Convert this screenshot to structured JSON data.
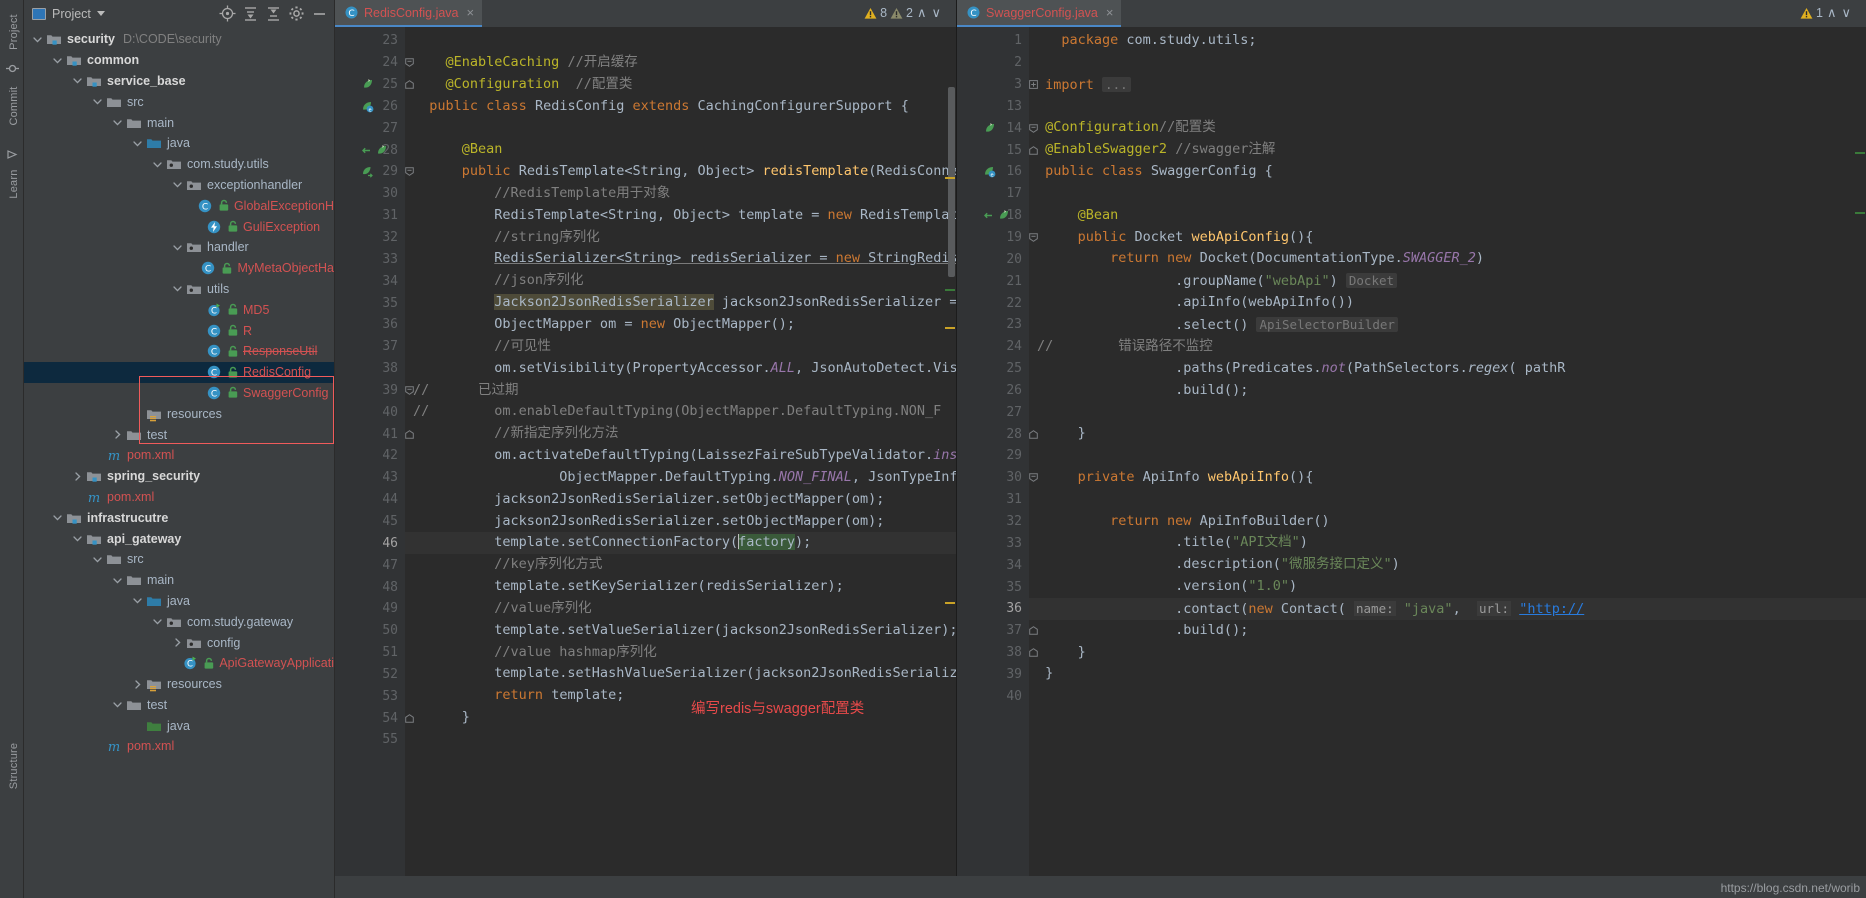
{
  "toolwindows": {
    "left_tabs": [
      "Project",
      "Commit",
      "Learn"
    ],
    "bottom_tab": "Structure"
  },
  "project_panel": {
    "title": "Project",
    "icons": [
      "locate-icon",
      "expand-all-icon",
      "collapse-all-icon",
      "settings-icon",
      "hide-icon"
    ],
    "tree": [
      {
        "depth": 0,
        "arrow": "down",
        "icon": "module-folder",
        "label": "security",
        "bold": true,
        "path": "D:\\CODE\\security"
      },
      {
        "depth": 1,
        "arrow": "down",
        "icon": "module-folder",
        "label": "common",
        "bold": true
      },
      {
        "depth": 2,
        "arrow": "down",
        "icon": "module-folder",
        "label": "service_base",
        "bold": true
      },
      {
        "depth": 3,
        "arrow": "down",
        "icon": "folder",
        "label": "src"
      },
      {
        "depth": 4,
        "arrow": "down",
        "icon": "folder",
        "label": "main"
      },
      {
        "depth": 5,
        "arrow": "down",
        "icon": "source-folder",
        "label": "java"
      },
      {
        "depth": 6,
        "arrow": "down",
        "icon": "package",
        "label": "com.study.utils"
      },
      {
        "depth": 7,
        "arrow": "down",
        "icon": "package",
        "label": "exceptionhandler"
      },
      {
        "depth": 8,
        "arrow": "none",
        "icon": "java-class",
        "label": "GlobalExceptionH",
        "kind": "class"
      },
      {
        "depth": 8,
        "arrow": "none",
        "icon": "java-annotation",
        "label": "GuliException",
        "kind": "class"
      },
      {
        "depth": 7,
        "arrow": "down",
        "icon": "package",
        "label": "handler"
      },
      {
        "depth": 8,
        "arrow": "none",
        "icon": "java-class",
        "label": "MyMetaObjectHa",
        "kind": "class"
      },
      {
        "depth": 7,
        "arrow": "down",
        "icon": "package",
        "label": "utils"
      },
      {
        "depth": 8,
        "arrow": "none",
        "icon": "java-class-run",
        "label": "MD5",
        "kind": "class"
      },
      {
        "depth": 8,
        "arrow": "none",
        "icon": "java-class",
        "label": "R",
        "kind": "class"
      },
      {
        "depth": 8,
        "arrow": "none",
        "icon": "java-class",
        "label": "ResponseUtil",
        "kind": "class",
        "strike": true
      },
      {
        "depth": 8,
        "arrow": "none",
        "icon": "java-class",
        "label": "RedisConfig",
        "kind": "class",
        "selected": true
      },
      {
        "depth": 8,
        "arrow": "none",
        "icon": "java-class",
        "label": "SwaggerConfig",
        "kind": "class"
      },
      {
        "depth": 5,
        "arrow": "none",
        "icon": "resources-folder",
        "label": "resources"
      },
      {
        "depth": 4,
        "arrow": "right",
        "icon": "folder",
        "label": "test"
      },
      {
        "depth": 3,
        "arrow": "none",
        "icon": "maven",
        "label": "pom.xml",
        "kind": "class"
      },
      {
        "depth": 2,
        "arrow": "right",
        "icon": "module-folder",
        "label": "spring_security",
        "bold": true
      },
      {
        "depth": 2,
        "arrow": "none",
        "icon": "maven",
        "label": "pom.xml",
        "kind": "class"
      },
      {
        "depth": 1,
        "arrow": "down",
        "icon": "module-folder",
        "label": "infrastrucutre",
        "bold": true
      },
      {
        "depth": 2,
        "arrow": "down",
        "icon": "module-folder",
        "label": "api_gateway",
        "bold": true
      },
      {
        "depth": 3,
        "arrow": "down",
        "icon": "folder",
        "label": "src"
      },
      {
        "depth": 4,
        "arrow": "down",
        "icon": "folder",
        "label": "main"
      },
      {
        "depth": 5,
        "arrow": "down",
        "icon": "source-folder",
        "label": "java"
      },
      {
        "depth": 6,
        "arrow": "down",
        "icon": "package",
        "label": "com.study.gateway"
      },
      {
        "depth": 7,
        "arrow": "right",
        "icon": "package",
        "label": "config"
      },
      {
        "depth": 7,
        "arrow": "none",
        "icon": "java-class-run",
        "label": "ApiGatewayApplicati",
        "kind": "class"
      },
      {
        "depth": 5,
        "arrow": "right",
        "icon": "resources-folder",
        "label": "resources"
      },
      {
        "depth": 4,
        "arrow": "down",
        "icon": "folder",
        "label": "test"
      },
      {
        "depth": 5,
        "arrow": "none",
        "icon": "source-folder-test",
        "label": "java"
      },
      {
        "depth": 3,
        "arrow": "none",
        "icon": "maven",
        "label": "pom.xml",
        "kind": "class"
      }
    ]
  },
  "left_editor": {
    "tab": {
      "label": "RedisConfig.java",
      "icon": "java-class-icon",
      "close": "×"
    },
    "inspections": {
      "error_count": "8",
      "warning_count": "2",
      "up": "∧",
      "down": "∨"
    },
    "first_line": 23,
    "current_line": 46,
    "lines": [
      {
        "n": 23,
        "html": ""
      },
      {
        "n": 24,
        "html": "    <span class=\"ann\">@EnableCaching</span> <span class=\"cmt\">//开启缓存</span>",
        "fold": "minus"
      },
      {
        "n": 25,
        "html": "    <span class=\"ann\">@Configuration</span>  <span class=\"cmt\">//配置类</span>",
        "gutter": "bean",
        "fold": "end"
      },
      {
        "n": 26,
        "html": "  <span class=\"kw\">public class </span>RedisConfig<span class=\"kw\"> extends </span>CachingConfigurerSupport {",
        "gutter": "bean2"
      },
      {
        "n": 27,
        "html": ""
      },
      {
        "n": 28,
        "html": "      <span class=\"ann\">@Bean</span>",
        "gutter": "bean-arrow"
      },
      {
        "n": 29,
        "html": "      <span class=\"kw\">public </span>RedisTemplate&lt;String, Object&gt; <span class=\"mth\">redisTemplate</span>(RedisConne",
        "gutter": "impl",
        "fold": "minus"
      },
      {
        "n": 30,
        "html": "          <span class=\"cmt\">//RedisTemplate用于对象</span>"
      },
      {
        "n": 31,
        "html": "          RedisTemplate&lt;String, Object&gt; template = <span class=\"kw\">new </span>RedisTemplat"
      },
      {
        "n": 32,
        "html": "          <span class=\"cmt\">//string序列化</span>"
      },
      {
        "n": 33,
        "html": "          <span class=\"undl\">RedisSerializer&lt;String&gt; redisSerializer = <span class=\"kw\">new </span>StringRedis</span>"
      },
      {
        "n": 34,
        "html": "          <span class=\"cmt\">//json序列化</span>"
      },
      {
        "n": 35,
        "html": "          <span class=\"hl\">Jackson2JsonRedisSerializer</span> jackson2JsonRedisSerializer ="
      },
      {
        "n": 36,
        "html": "          ObjectMapper om = <span class=\"kw\">new </span>ObjectMapper();"
      },
      {
        "n": 37,
        "html": "          <span class=\"cmt\">//可见性</span>"
      },
      {
        "n": 38,
        "html": "          om.setVisibility(PropertyAccessor.<span class=\"sfld\">ALL</span>, JsonAutoDetect.Vis"
      },
      {
        "n": 39,
        "html": "<span class=\"cmt\">//      已过期</span>",
        "fold": "minus",
        "comment_row": true
      },
      {
        "n": 40,
        "html": "<span class=\"cmt\">//        om.enableDefaultTyping(ObjectMapper.DefaultTyping.NON_F</span>",
        "comment_row": true
      },
      {
        "n": 41,
        "html": "          <span class=\"cmt\">//新指定序列化方法</span>",
        "fold": "end"
      },
      {
        "n": 42,
        "html": "          om.activateDefaultTyping(LaissezFaireSubTypeValidator.<span class=\"sfld\">ins</span>"
      },
      {
        "n": 43,
        "html": "                  ObjectMapper.DefaultTyping.<span class=\"sfld\">NON_FINAL</span>, JsonTypeInf"
      },
      {
        "n": 44,
        "html": "          jackson2JsonRedisSerializer.setObjectMapper(om);"
      },
      {
        "n": 45,
        "html": "          jackson2JsonRedisSerializer.setObjectMapper(om);"
      },
      {
        "n": 46,
        "html": "          template.setConnectionFactory(<span class=\"selgreen\"><span class=\"caretbar\"></span>factory</span>);",
        "current": true
      },
      {
        "n": 47,
        "html": "          <span class=\"cmt\">//key序列化方式</span>"
      },
      {
        "n": 48,
        "html": "          template.setKeySerializer(redisSerializer);"
      },
      {
        "n": 49,
        "html": "          <span class=\"cmt\">//value序列化</span>"
      },
      {
        "n": 50,
        "html": "          template.setValueSerializer(jackson2JsonRedisSerializer);"
      },
      {
        "n": 51,
        "html": "          <span class=\"cmt\">//value hashmap序列化</span>"
      },
      {
        "n": 52,
        "html": "          template.setHashValueSerializer(jackson2JsonRedisSerializ"
      },
      {
        "n": 53,
        "html": "          <span class=\"kw\">return </span>template;"
      },
      {
        "n": 54,
        "html": "      }",
        "fold": "end"
      },
      {
        "n": 55,
        "html": ""
      }
    ]
  },
  "right_editor": {
    "tab": {
      "label": "SwaggerConfig.java",
      "icon": "java-class-icon",
      "close": "×"
    },
    "inspections": {
      "warning_count": "1",
      "up": "∧",
      "down": "∨"
    },
    "current_line": 36,
    "lines": [
      {
        "n": 1,
        "html": "   <span class=\"kw\">package </span>com.study.utils;"
      },
      {
        "n": 2,
        "html": ""
      },
      {
        "n": 3,
        "html": " <span class=\"kw\">import </span><span class=\"hint\">...</span>",
        "fold": "plus"
      },
      {
        "n": 13,
        "html": ""
      },
      {
        "n": 14,
        "html": " <span class=\"ann\">@Configuration</span><span class=\"cmt\">//配置类</span>",
        "gutter": "bean",
        "fold": "minus"
      },
      {
        "n": 15,
        "html": " <span class=\"ann\">@EnableSwagger2</span> <span class=\"cmt\">//swagger注解</span>",
        "fold": "end"
      },
      {
        "n": 16,
        "html": " <span class=\"kw\">public class </span>SwaggerConfig {",
        "gutter": "bean2"
      },
      {
        "n": 17,
        "html": ""
      },
      {
        "n": 18,
        "html": "     <span class=\"ann\">@Bean</span>",
        "gutter": "bean-arrow"
      },
      {
        "n": 19,
        "html": "     <span class=\"kw\">public </span>Docket <span class=\"mth\">webApiConfig</span>(){",
        "fold": "minus"
      },
      {
        "n": 20,
        "html": "         <span class=\"kw\">return new </span>Docket(DocumentationType.<span class=\"sfld\">SWAGGER_2</span>)"
      },
      {
        "n": 21,
        "html": "                 .groupName(<span class=\"str\">\"webApi\"</span>) <span class=\"hint\">Docket</span>"
      },
      {
        "n": 22,
        "html": "                 .apiInfo(webApiInfo())"
      },
      {
        "n": 23,
        "html": "                 .select() <span class=\"hint\">ApiSelectorBuilder</span>"
      },
      {
        "n": 24,
        "html": "<span class=\"cmt\">//        错误路径不监控</span>",
        "comment_row": true
      },
      {
        "n": 25,
        "html": "                 .paths(Predicates.<span class=\"sfld\">not</span>(PathSelectors.<span class=\"ital\">regex</span>( pathR"
      },
      {
        "n": 26,
        "html": "                 .build();"
      },
      {
        "n": 27,
        "html": ""
      },
      {
        "n": 28,
        "html": "     }",
        "fold": "end"
      },
      {
        "n": 29,
        "html": ""
      },
      {
        "n": 30,
        "html": "     <span class=\"kw\">private </span>ApiInfo <span class=\"mth\">webApiInfo</span>(){",
        "fold": "minus"
      },
      {
        "n": 31,
        "html": ""
      },
      {
        "n": 32,
        "html": "         <span class=\"kw\">return new </span>ApiInfoBuilder()"
      },
      {
        "n": 33,
        "html": "                 .title(<span class=\"str\">\"API文档\"</span>)"
      },
      {
        "n": 34,
        "html": "                 .description(<span class=\"str\">\"微服务接口定义\"</span>)"
      },
      {
        "n": 35,
        "html": "                 .version(<span class=\"str\">\"1.0\"</span>)"
      },
      {
        "n": 36,
        "html": "                 .contact(<span class=\"kw\">new </span>Contact( <span class=\"param\">name:</span> <span class=\"str\">\"java\"</span>,  <span class=\"param\">url:</span> <span class=\"link\">\"http://</span>",
        "current": true
      },
      {
        "n": 37,
        "html": "                 .build();",
        "fold": "end"
      },
      {
        "n": 38,
        "html": "     }",
        "fold": "end"
      },
      {
        "n": 39,
        "html": " }"
      },
      {
        "n": 40,
        "html": ""
      }
    ]
  },
  "annotation": {
    "text": "编写redis与swagger配置类",
    "color": "#e84a4a"
  },
  "status": {
    "blog_url": "https://blog.csdn.net/worib"
  },
  "colors": {
    "accent_blue": "#4a88c7",
    "selection": "#0d293e",
    "editor_bg": "#2b2b2b",
    "gutter_bg": "#313335",
    "panel_bg": "#3c3f41",
    "annotation_red": "#e84a4a",
    "highlight_box": "#f05b5b"
  }
}
